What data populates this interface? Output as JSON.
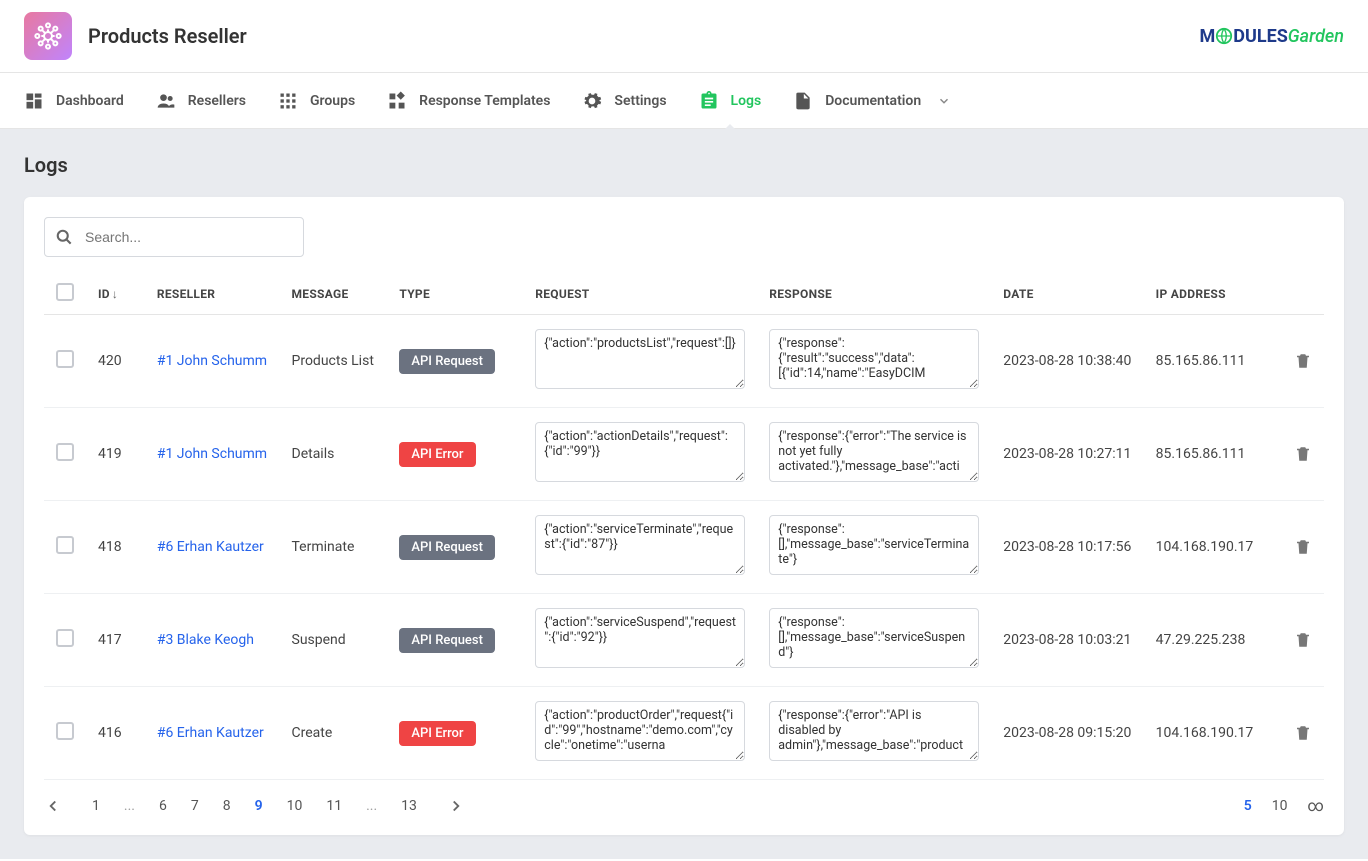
{
  "header": {
    "title": "Products Reseller",
    "logo_highlight": "M",
    "logo_dules": "DULES",
    "logo_garden": "Garden"
  },
  "nav": [
    {
      "label": "Dashboard",
      "icon": "dashboard-icon"
    },
    {
      "label": "Resellers",
      "icon": "people-icon"
    },
    {
      "label": "Groups",
      "icon": "apps-icon"
    },
    {
      "label": "Response Templates",
      "icon": "widgets-icon"
    },
    {
      "label": "Settings",
      "icon": "gear-icon"
    },
    {
      "label": "Logs",
      "icon": "assignment-icon",
      "active": true
    },
    {
      "label": "Documentation",
      "icon": "description-icon",
      "dropdown": true
    }
  ],
  "page": {
    "title": "Logs"
  },
  "search": {
    "placeholder": "Search..."
  },
  "table": {
    "headers": {
      "id": "ID",
      "reseller": "RESELLER",
      "message": "MESSAGE",
      "type": "TYPE",
      "request": "REQUEST",
      "response": "RESPONSE",
      "date": "DATE",
      "ip": "IP ADDRESS"
    },
    "rows": [
      {
        "id": "420",
        "reseller": "#1 John Schumm",
        "message": "Products List",
        "type": "API Request",
        "type_kind": "req",
        "request": "{\"action\":\"productsList\",\"request\":[]}",
        "response": "{\"response\":{\"result\":\"success\",\"data\":[{\"id\":14,\"name\":\"EasyDCIM",
        "date": "2023-08-28 10:38:40",
        "ip": "85.165.86.111"
      },
      {
        "id": "419",
        "reseller": "#1 John Schumm",
        "message": "Details",
        "type": "API Error",
        "type_kind": "err",
        "request": "{\"action\":\"actionDetails\",\"request\":{\"id\":\"99\"}}",
        "response": "{\"response\":{\"error\":\"The service is not yet fully activated.\"},\"message_base\":\"acti",
        "date": "2023-08-28 10:27:11",
        "ip": "85.165.86.111"
      },
      {
        "id": "418",
        "reseller": "#6 Erhan Kautzer",
        "message": "Terminate",
        "type": "API Request",
        "type_kind": "req",
        "request": "{\"action\":\"serviceTerminate\",\"request\":{\"id\":\"87\"}}",
        "response": "{\"response\":[],\"message_base\":\"serviceTerminate\"}",
        "date": "2023-08-28 10:17:56",
        "ip": "104.168.190.17"
      },
      {
        "id": "417",
        "reseller": "#3 Blake Keogh",
        "message": "Suspend",
        "type": "API Request",
        "type_kind": "req",
        "request": "{\"action\":\"serviceSuspend\",\"request\":{\"id\":\"92\"}}",
        "response": "{\"response\":[],\"message_base\":\"serviceSuspend\"}",
        "date": "2023-08-28 10:03:21",
        "ip": "47.29.225.238"
      },
      {
        "id": "416",
        "reseller": "#6 Erhan Kautzer",
        "message": "Create",
        "type": "API Error",
        "type_kind": "err",
        "request": "{\"action\":\"productOrder\",\"request{\"id\":\"99\",\"hostname\":\"demo.com\",\"cycle\":\"onetime\":\"userna",
        "response": "{\"response\":{\"error\":\"API is disabled by admin\"},\"message_base\":\"product",
        "date": "2023-08-28 09:15:20",
        "ip": "104.168.190.17"
      }
    ]
  },
  "pagination": {
    "pages": [
      "1",
      "...",
      "6",
      "7",
      "8",
      "9",
      "10",
      "11",
      "...",
      "13"
    ],
    "active": "9",
    "sizes": [
      "5",
      "10",
      "∞"
    ],
    "active_size": "5"
  }
}
